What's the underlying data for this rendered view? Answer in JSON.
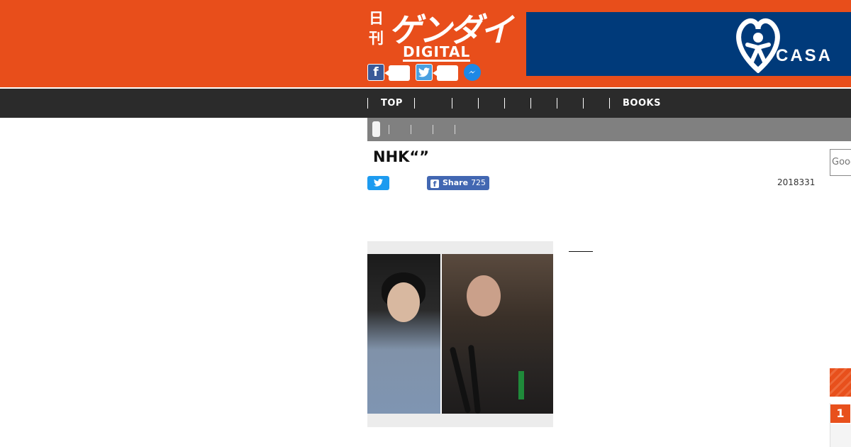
{
  "header": {
    "logo": {
      "kanji": "日刊",
      "kana": "ゲンダイ",
      "digital": "DIGITAL"
    },
    "bg_color": "#e84e1b",
    "share_icons": [
      "facebook-icon",
      "twitter-icon",
      "messenger-icon"
    ],
    "ad": {
      "brand": "CASA",
      "bg_color": "#003a7a"
    }
  },
  "nav": {
    "items": [
      "TOP",
      "",
      "",
      "",
      "",
      "",
      "",
      "",
      "BOOKS"
    ]
  },
  "article": {
    "title": "NHK“”",
    "share": {
      "facebook_label": "Share",
      "facebook_count": "725"
    },
    "date": "2018331"
  },
  "search": {
    "placeholder": "Google"
  },
  "ranking": {
    "number": "1"
  }
}
